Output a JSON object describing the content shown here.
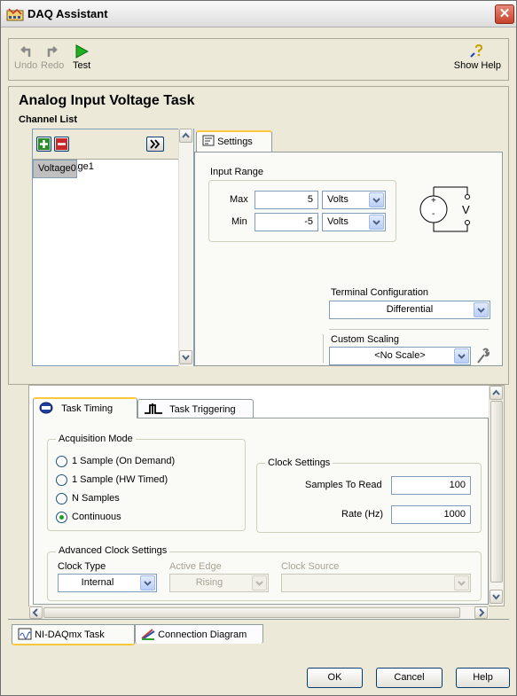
{
  "window": {
    "title": "DAQ Assistant",
    "close_glyph": "✕"
  },
  "toolbar": {
    "undo": "Undo",
    "redo": "Redo",
    "test": "Test",
    "help": "Show Help"
  },
  "task": {
    "title": "Analog Input Voltage Task",
    "channel_list_label": "Channel List"
  },
  "channels": [
    "Voltage0",
    "Voltage1"
  ],
  "settings": {
    "tab_label": "Settings",
    "input_range_label": "Input Range",
    "max_label": "Max",
    "max_value": "5",
    "max_units": "Volts",
    "min_label": "Min",
    "min_value": "-5",
    "min_units": "Volts",
    "schematic_v": "V",
    "schematic_plus": "+",
    "schematic_minus": "-",
    "terminal_label": "Terminal Configuration",
    "terminal_value": "Differential",
    "scaling_label": "Custom Scaling",
    "scaling_value": "<No Scale>"
  },
  "timing": {
    "tab_timing": "Task Timing",
    "tab_triggering": "Task Triggering",
    "acq_mode_label": "Acquisition Mode",
    "modes": [
      {
        "label": "1 Sample (On Demand)",
        "selected": false
      },
      {
        "label": "1 Sample (HW Timed)",
        "selected": false
      },
      {
        "label": "N Samples",
        "selected": false
      },
      {
        "label": "Continuous",
        "selected": true
      }
    ],
    "clock_settings_label": "Clock Settings",
    "samples_label": "Samples To Read",
    "samples_value": "100",
    "rate_label": "Rate (Hz)",
    "rate_value": "1000",
    "adv_label": "Advanced Clock Settings",
    "clock_type_label": "Clock Type",
    "clock_type_value": "Internal",
    "active_edge_label": "Active Edge",
    "active_edge_value": "Rising",
    "clock_source_label": "Clock Source",
    "clock_source_value": ""
  },
  "bottom_tabs": {
    "daqmx": "NI-DAQmx Task",
    "connection": "Connection Diagram"
  },
  "buttons": {
    "ok": "OK",
    "cancel": "Cancel",
    "help": "Help"
  },
  "colors": {
    "accent_tab": "#ffc83c",
    "selection": "#c0c0c0",
    "test_green": "#21b021"
  }
}
